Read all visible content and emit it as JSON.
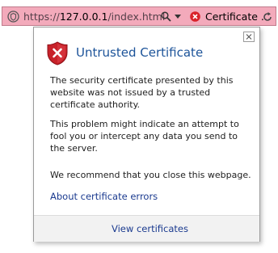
{
  "addressbar": {
    "url_prefix": "https://",
    "url_host": "127.0.0.1",
    "url_path": "/index.html",
    "cert_label": "Certificate ...",
    "icons": {
      "site": "site-identity-icon",
      "search": "search-icon",
      "dropdown": "chevron-down-icon",
      "error": "certificate-error-icon",
      "refresh": "refresh-icon"
    },
    "colors": {
      "background": "#f3aabb",
      "error": "#d9222a"
    }
  },
  "popup": {
    "title": "Untrusted Certificate",
    "paragraph1": "The security certificate presented by this website was not issued by a trusted certificate authority.",
    "paragraph2": "This problem might indicate an attempt to fool you or intercept any data you send to the server.",
    "paragraph3": "We recommend that you close this webpage.",
    "about_link": "About certificate errors",
    "view_link": "View certificates",
    "colors": {
      "title": "#1c5399",
      "shield": "#c8222a",
      "link": "#1a3a8f"
    }
  }
}
